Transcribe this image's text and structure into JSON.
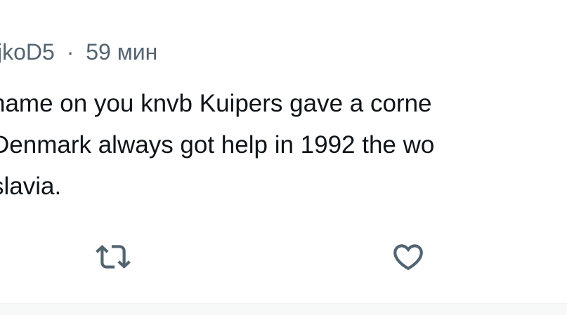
{
  "tweet": {
    "username": "jkoD5",
    "separator": "·",
    "time": "59 мин",
    "lines": [
      "hame on you knvb Kuipers gave a corne",
      "Denmark always got help in 1992 the wo",
      "slavia."
    ]
  },
  "actions": {
    "retweet_icon": "retweet-icon",
    "like_icon": "heart-icon"
  },
  "colors": {
    "text": "#0f1419",
    "muted": "#536471",
    "icon": "#536471"
  }
}
